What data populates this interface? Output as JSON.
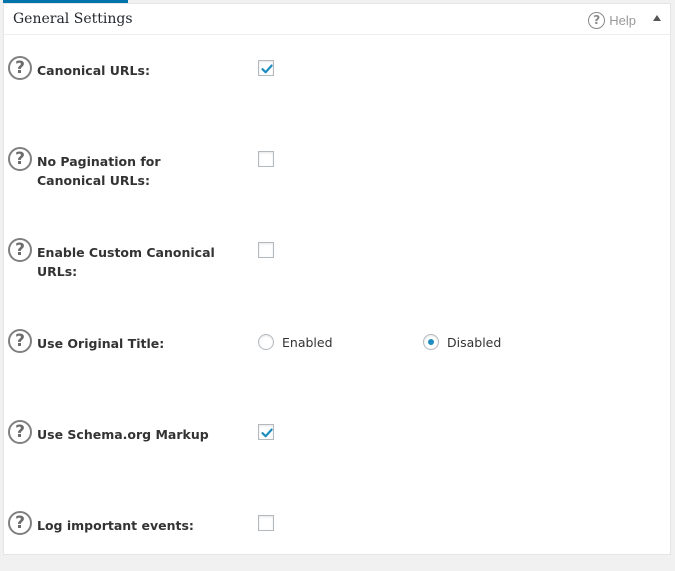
{
  "panel": {
    "title": "General Settings",
    "help_label": "Help",
    "help_icon": "question-circle-icon",
    "collapse_icon": "triangle-up-icon"
  },
  "settings": [
    {
      "label": "Canonical URLs:",
      "type": "checkbox",
      "checked": true
    },
    {
      "label": "No Pagination for Canonical URLs:",
      "type": "checkbox",
      "checked": false
    },
    {
      "label": "Enable Custom Canonical URLs:",
      "type": "checkbox",
      "checked": false
    },
    {
      "label": "Use Original Title:",
      "type": "radio",
      "options": [
        {
          "label": "Enabled",
          "selected": false
        },
        {
          "label": "Disabled",
          "selected": true
        }
      ]
    },
    {
      "label": "Use Schema.org Markup",
      "type": "checkbox",
      "checked": true
    },
    {
      "label": "Log important events:",
      "type": "checkbox",
      "checked": false
    }
  ],
  "colors": {
    "accent": "#1e8cbe",
    "tab": "#0073aa"
  }
}
